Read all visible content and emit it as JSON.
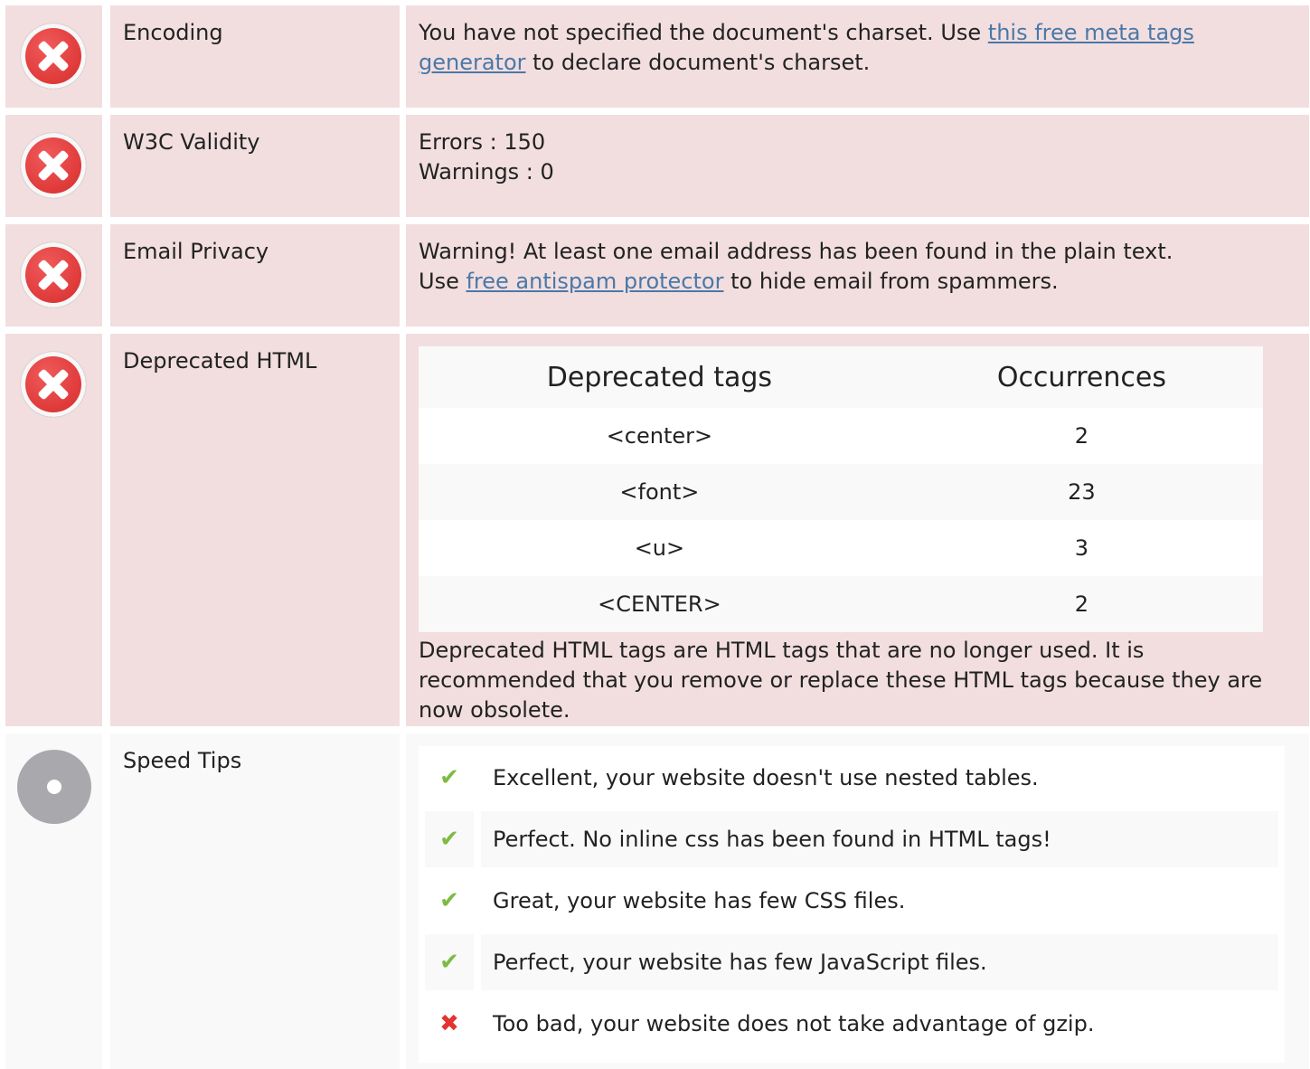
{
  "rows": [
    {
      "label": "Encoding",
      "status": "error",
      "text_before": "You have not specified the document's charset. Use ",
      "link": "this free meta tags generator",
      "text_after": " to declare document's charset."
    },
    {
      "label": "W3C Validity",
      "status": "error",
      "errors": "Errors : 150",
      "warnings": "Warnings : 0"
    },
    {
      "label": "Email Privacy",
      "status": "error",
      "line1": "Warning! At least one email address has been found in the plain text.",
      "text_before": "Use ",
      "link": "free antispam protector",
      "text_after": " to hide email from spammers."
    },
    {
      "label": "Deprecated HTML",
      "status": "error",
      "table_headers": [
        "Deprecated tags",
        "Occurrences"
      ],
      "table_rows": [
        [
          "<center>",
          "2"
        ],
        [
          "<font>",
          "23"
        ],
        [
          "<u>",
          "3"
        ],
        [
          "<CENTER>",
          "2"
        ]
      ],
      "note": "Deprecated HTML tags are HTML tags that are no longer used. It is recommended that you remove or replace these HTML tags because they are now obsolete."
    },
    {
      "label": "Speed Tips",
      "status": "neutral",
      "tips": [
        {
          "ok": true,
          "text": "Excellent, your website doesn't use nested tables."
        },
        {
          "ok": true,
          "text": "Perfect. No inline css has been found in HTML tags!"
        },
        {
          "ok": true,
          "text": "Great, your website has few CSS files."
        },
        {
          "ok": true,
          "text": "Perfect, your website has few JavaScript files."
        },
        {
          "ok": false,
          "text": "Too bad, your website does not take advantage of gzip."
        }
      ]
    }
  ],
  "icons": {
    "error": "error-x-icon",
    "neutral": "neutral-dot-icon",
    "pass": "checkmark-icon",
    "fail": "cross-icon"
  },
  "colors": {
    "error_bg": "#f2dedf",
    "neutral_bg": "#f9f9f9",
    "link": "#4a78a8",
    "check": "#7dbb45",
    "cross": "#e3342f"
  }
}
